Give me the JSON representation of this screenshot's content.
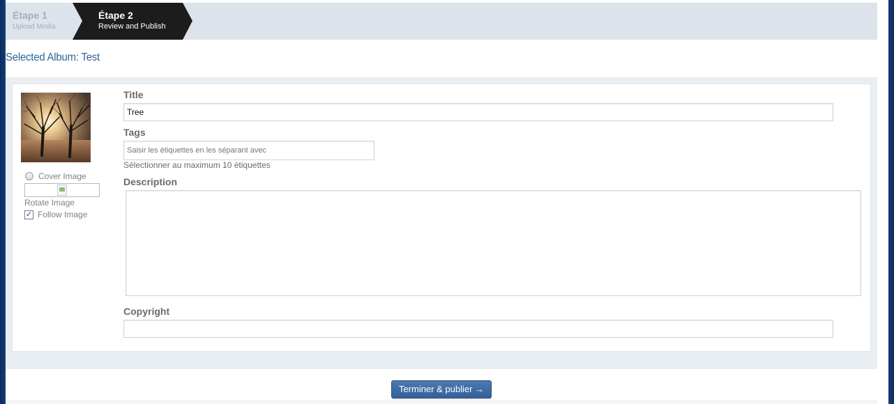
{
  "stepper": {
    "steps": [
      {
        "title": "Étape 1",
        "subtitle": "Upload Media",
        "active": false
      },
      {
        "title": "Étape 2",
        "subtitle": "Review and Publish",
        "active": true
      }
    ]
  },
  "album": {
    "label": "Selected Album:",
    "name": "Test"
  },
  "media": {
    "cover_label": "Cover Image",
    "rotate_label": "Rotate Image",
    "follow_label": "Follow Image",
    "follow_checked": true,
    "cover_checked": false
  },
  "form": {
    "title_label": "Title",
    "title_value": "Tree",
    "tags_label": "Tags",
    "tags_placeholder": "Saisir les étiquettes en les séparant avec",
    "tags_hint": "Sélectionner au maximum 10 étiquettes",
    "description_label": "Description",
    "description_value": "",
    "copyright_label": "Copyright",
    "copyright_value": ""
  },
  "actions": {
    "publish_label": "Terminer & publier →"
  },
  "colors": {
    "accent": "#2a6496",
    "button": "#3d6aa5",
    "active_step": "#1b1b1b"
  }
}
